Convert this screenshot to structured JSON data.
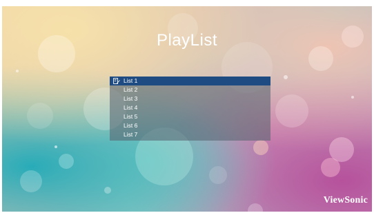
{
  "screen": {
    "title": "PlayList"
  },
  "playlist": {
    "items": [
      {
        "label": "List 1"
      },
      {
        "label": "List 2"
      },
      {
        "label": "List 3"
      },
      {
        "label": "List 4"
      },
      {
        "label": "List 5"
      },
      {
        "label": "List 6"
      },
      {
        "label": "List 7"
      }
    ],
    "selected": "List 1"
  },
  "brand": {
    "logo": "ViewSonic"
  },
  "colors": {
    "selection": "#1e4c82",
    "list_background": "rgba(88,100,112,0.58)",
    "text": "#ffffff"
  },
  "icons": {
    "selected_item": "edit-document-icon"
  }
}
